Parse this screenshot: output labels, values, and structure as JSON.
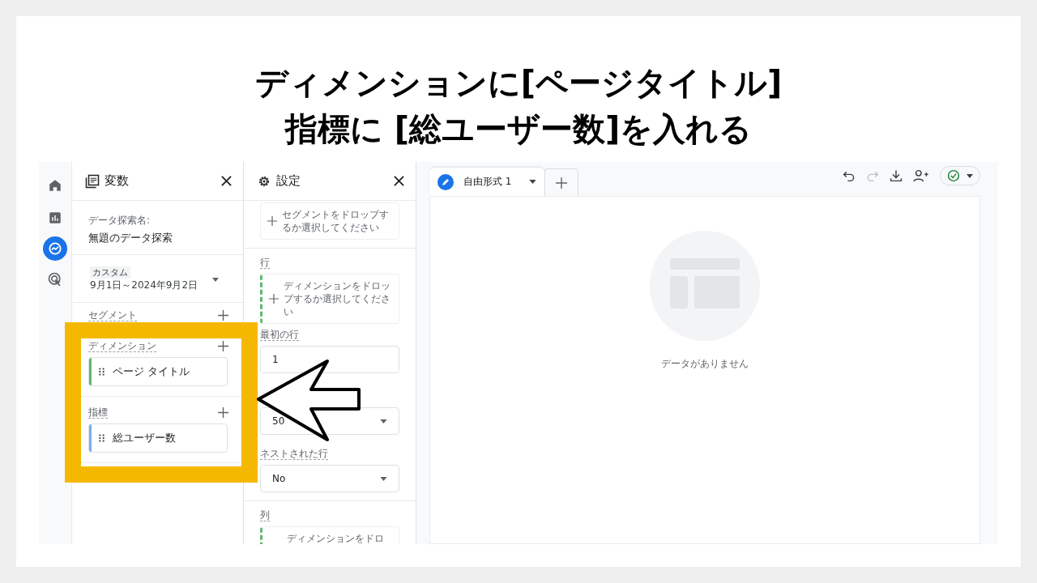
{
  "slide_title": [
    "ディメンションに[ページタイトル]",
    "指標に [総ユーザー数]を入れる"
  ],
  "nav_rail": [
    {
      "kind": "home",
      "selected": false
    },
    {
      "kind": "reports",
      "selected": false
    },
    {
      "kind": "explore",
      "selected": true
    },
    {
      "kind": "advertising",
      "selected": false
    }
  ],
  "variables_panel": {
    "title": "変数",
    "name_label": "データ探索名:",
    "name": "無題のデータ探索",
    "date_tag": "カスタム",
    "date_range": "9月1日～2024年9月2日",
    "sections": [
      {
        "label": "セグメント"
      },
      {
        "label": "ディメンション",
        "items": [
          {
            "name": "ページ タイトル",
            "color": "#5bb974"
          }
        ]
      },
      {
        "label": "指標",
        "items": [
          {
            "name": "総ユーザー数",
            "color": "#7baaf7"
          }
        ]
      }
    ]
  },
  "settings_panel": {
    "title": "設定",
    "segment_drop": "セグメントをドロップするか選択してください",
    "rows": {
      "label": "行",
      "drop": "ディメンションをドロップするか選択してください"
    },
    "first_row": {
      "label": "最初の行",
      "value": "1"
    },
    "rows_shown": {
      "value": "50"
    },
    "nested_rows": {
      "label": "ネストされた行",
      "value": "No"
    },
    "columns": {
      "label": "列",
      "drop": "ディメンションをドロ"
    }
  },
  "canvas": {
    "tabs": [
      {
        "label": "自由形式 1",
        "selected": true
      }
    ],
    "empty_message": "データがありません"
  }
}
